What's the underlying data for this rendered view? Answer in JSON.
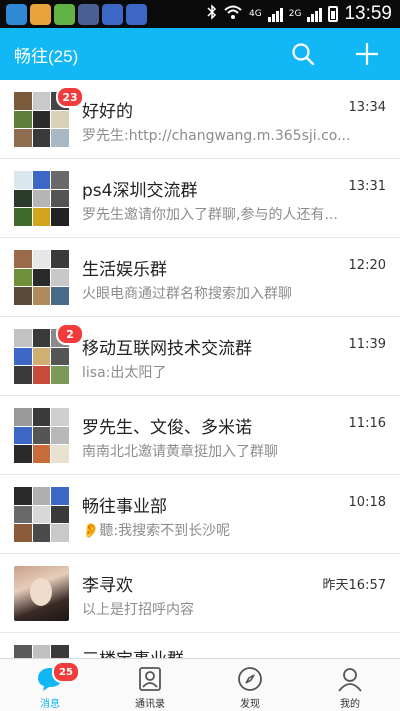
{
  "status_bar": {
    "time": "13:59",
    "network_1": "4G",
    "network_2": "2G",
    "apps": [
      {
        "icon": "qq-icon",
        "color": "#2f8ad6"
      },
      {
        "icon": "app-grid-icon",
        "color": "#e8a43a"
      },
      {
        "icon": "app-grid-icon",
        "color": "#62b346"
      },
      {
        "icon": "phone-icon",
        "color": "#4a5f93"
      },
      {
        "icon": "weibo-icon",
        "color": "#3c67c6"
      },
      {
        "icon": "weibo-icon",
        "color": "#3c67c6"
      }
    ]
  },
  "header": {
    "title": "畅往(25)",
    "accent_color": "#12b7f5"
  },
  "chats": [
    {
      "name": "好好的",
      "time": "13:34",
      "preview": "罗先生:http://changwang.m.365sji.co...",
      "badge": "23",
      "tiles": [
        "#7a5a3c",
        "#c9c9c9",
        "#444",
        "#5d7d3a",
        "#2b2b2b",
        "#d9d0b8",
        "#8d6c4f",
        "#3a3a3a",
        "#a8b7c4"
      ]
    },
    {
      "name": "ps4深圳交流群",
      "time": "13:31",
      "preview": "罗先生邀请你加入了群聊,参与的人还有...",
      "badge": "",
      "tiles": [
        "#dbe7ef",
        "#3c67c6",
        "#6a6a6a",
        "#2b3b2b",
        "#b5b5b5",
        "#545454",
        "#3f6a2b",
        "#d3a41e",
        "#222"
      ]
    },
    {
      "name": "生活娱乐群",
      "time": "12:20",
      "preview": "火眼电商通过群名称搜索加入群聊",
      "badge": "",
      "tiles": [
        "#9a6a4a",
        "#e7e7e7",
        "#3a3a3a",
        "#6f8f3a",
        "#2a2a2a",
        "#c8c8c8",
        "#5a4a3a",
        "#b08a5a",
        "#4a6a8a"
      ]
    },
    {
      "name": "移动互联网技术交流群",
      "time": "11:39",
      "preview": "lisa:出太阳了",
      "badge": "2",
      "tiles": [
        "#c2c2c2",
        "#3a3a3a",
        "#8a8a8a",
        "#3c67c6",
        "#d0b070",
        "#555",
        "#3a3a3a",
        "#c84a3a",
        "#7a9a5a"
      ]
    },
    {
      "name": "罗先生、文俊、多米诺",
      "time": "11:16",
      "preview": "南南北北邀请黄章挺加入了群聊",
      "badge": "",
      "tiles": [
        "#9a9a9a",
        "#3a3a3a",
        "#cfcfcf",
        "#3c67c6",
        "#555",
        "#b8b8b8",
        "#2a2a2a",
        "#c86a3a",
        "#e8e0d0"
      ]
    },
    {
      "name": "畅往事业部",
      "time": "10:18",
      "preview": "👂聽:我搜索不到长沙呢",
      "badge": "",
      "tiles": [
        "#2a2a2a",
        "#b0b0b0",
        "#3c67c6",
        "#6a6a6a",
        "#d8d8d8",
        "#3a3a3a",
        "#8a5a3a",
        "#4a4a4a",
        "#c9c9c9"
      ]
    },
    {
      "name": "李寻欢",
      "time": "昨天16:57",
      "preview": "以上是打招呼内容",
      "badge": "",
      "photo": true
    },
    {
      "name": "三楼宝事业群",
      "time": "",
      "preview": "",
      "badge": "",
      "partial": true,
      "tiles": [
        "#5a5a5a",
        "#c0c0c0",
        "#3a3a3a",
        "#8a8a8a",
        "#2a2a2a",
        "#b0b0b0",
        "#6a6a6a",
        "#d0d0d0",
        "#444"
      ]
    }
  ],
  "tabs": [
    {
      "label": "消息",
      "icon": "message-icon",
      "active": true,
      "badge": "25"
    },
    {
      "label": "通讯录",
      "icon": "contacts-icon",
      "active": false,
      "badge": ""
    },
    {
      "label": "发现",
      "icon": "compass-icon",
      "active": false,
      "badge": ""
    },
    {
      "label": "我的",
      "icon": "profile-icon",
      "active": false,
      "badge": ""
    }
  ]
}
